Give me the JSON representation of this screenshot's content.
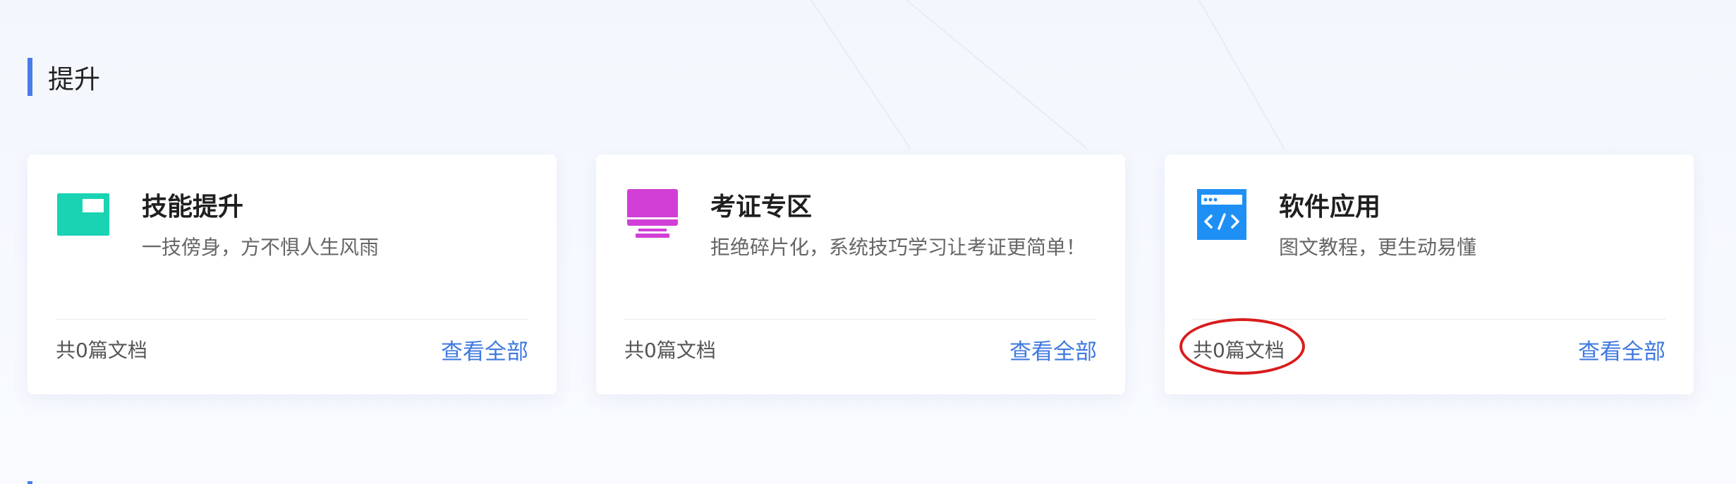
{
  "section": {
    "title": "提升"
  },
  "cards": [
    {
      "icon": "flag-board-icon",
      "title": "技能提升",
      "description": "一技傍身，方不惧人生风雨",
      "doc_count": "共0篇文档",
      "view_all": "查看全部",
      "icon_color": "#19d3b3"
    },
    {
      "icon": "monitor-icon",
      "title": "考证专区",
      "description": "拒绝碎片化，系统技巧学习让考证更简单！",
      "doc_count": "共0篇文档",
      "view_all": "查看全部",
      "icon_color": "#d13fd6"
    },
    {
      "icon": "code-window-icon",
      "title": "软件应用",
      "description": "图文教程，更生动易懂",
      "doc_count": "共0篇文档",
      "view_all": "查看全部",
      "icon_color": "#1e90f5"
    }
  ],
  "colors": {
    "accent": "#4a7bea",
    "link": "#3f79e0",
    "annotation": "#d91c1c"
  }
}
